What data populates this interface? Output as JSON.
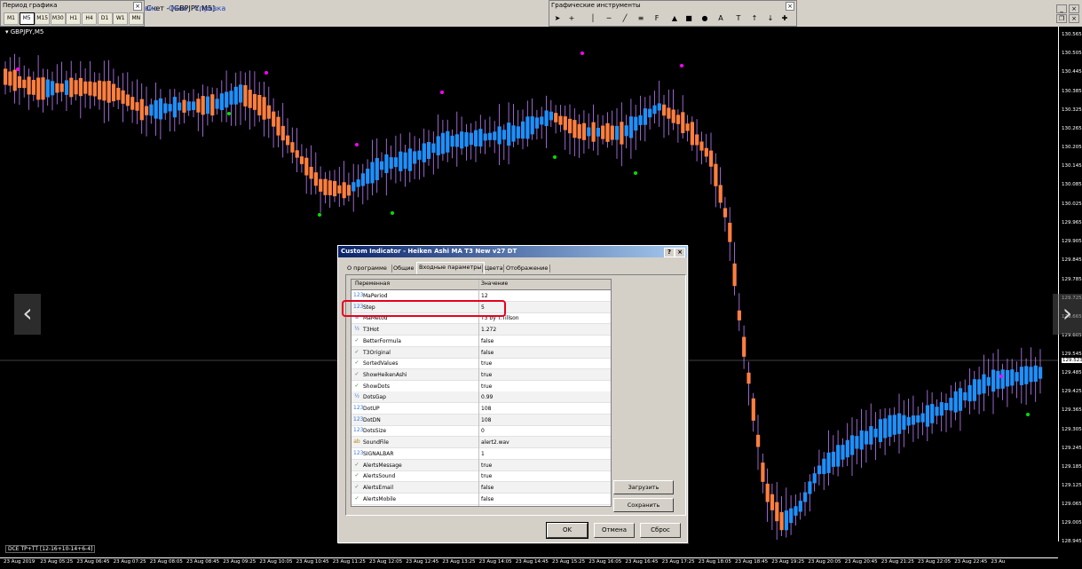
{
  "toolbar": {
    "period_panel_title": "Период графика",
    "periods": [
      "M1",
      "M5",
      "M15",
      "M30",
      "H1",
      "H4",
      "D1",
      "W1",
      "MN"
    ],
    "active_period": "M5",
    "account_label": "Счет - [GBPJPY,M5]",
    "menu": [
      "вис",
      "Окно",
      "Справка"
    ],
    "drawing_panel_title": "Графические инструменты",
    "drawing_tools": [
      "cursor",
      "crosshair",
      "vertical-line",
      "horizontal-line",
      "trend-line",
      "channel",
      "fibonacci",
      "triangle",
      "rectangle",
      "ellipse",
      "text",
      "label",
      "arrow-up",
      "arrow-down",
      "shapes"
    ]
  },
  "chart": {
    "symbol": "GBPJPY,M5",
    "status": "DCE TP+TT [12-16+10-14+6-4]",
    "current_price": "129.523",
    "y_labels": [
      "130.565",
      "130.505",
      "130.445",
      "130.385",
      "130.325",
      "130.265",
      "130.205",
      "130.145",
      "130.085",
      "130.025",
      "129.965",
      "129.905",
      "129.845",
      "129.785",
      "129.725",
      "129.665",
      "129.605",
      "129.545",
      "129.523",
      "129.485",
      "129.425",
      "129.365",
      "129.305",
      "129.245",
      "129.185",
      "129.125",
      "129.065",
      "129.005",
      "128.945"
    ],
    "x_labels": [
      "23 Aug 2019",
      "23 Aug 05:25",
      "23 Aug 06:45",
      "23 Aug 07:25",
      "23 Aug 08:05",
      "23 Aug 08:45",
      "23 Aug 09:25",
      "23 Aug 10:05",
      "23 Aug 10:45",
      "23 Aug 11:25",
      "23 Aug 12:05",
      "23 Aug 12:45",
      "23 Aug 13:25",
      "23 Aug 14:05",
      "23 Aug 14:45",
      "23 Aug 15:25",
      "23 Aug 16:05",
      "23 Aug 16:45",
      "23 Aug 17:25",
      "23 Aug 18:05",
      "23 Aug 18:45",
      "23 Aug 19:25",
      "23 Aug 20:05",
      "23 Aug 20:45",
      "23 Aug 21:25",
      "23 Aug 22:05",
      "23 Aug 22:45",
      "23 Au"
    ],
    "colors": {
      "bull": "#1e90ff",
      "bear": "#ff7f3f",
      "wick": "#c080ff",
      "dot_up": "#00e000",
      "dot_dn": "#ff00ff"
    }
  },
  "dialog": {
    "title": "Custom Indicator - Heiken Ashi MA T3 New v27 DT",
    "help": "?",
    "close": "×",
    "tabs": [
      "О программе",
      "Общие",
      "Входные параметры",
      "Цвета",
      "Отображение"
    ],
    "active_tab": "Входные параметры",
    "col_variable": "Переменная",
    "col_value": "Значение",
    "params": [
      {
        "name": "MaPeriod",
        "value": "12",
        "icon": "int"
      },
      {
        "name": "Step",
        "value": "5",
        "icon": "int"
      },
      {
        "name": "MaMetod",
        "value": "T3 by T.Tillson",
        "icon": "enum"
      },
      {
        "name": "T3Hot",
        "value": "1.272",
        "icon": "dbl"
      },
      {
        "name": "BetterFormula",
        "value": "false",
        "icon": "bool"
      },
      {
        "name": "T3Original",
        "value": "false",
        "icon": "bool"
      },
      {
        "name": "SortedValues",
        "value": "true",
        "icon": "bool"
      },
      {
        "name": "ShowHeikenAshi",
        "value": "true",
        "icon": "bool"
      },
      {
        "name": "ShowDots",
        "value": "true",
        "icon": "bool"
      },
      {
        "name": "DotsGap",
        "value": "0.99",
        "icon": "dbl"
      },
      {
        "name": "DotUP",
        "value": "108",
        "icon": "int"
      },
      {
        "name": "DotDN",
        "value": "108",
        "icon": "int"
      },
      {
        "name": "DotsSize",
        "value": "0",
        "icon": "int"
      },
      {
        "name": "SoundFile",
        "value": "alert2.wav",
        "icon": "str"
      },
      {
        "name": "SIGNALBAR",
        "value": "1",
        "icon": "int"
      },
      {
        "name": "AlertsMessage",
        "value": "true",
        "icon": "bool"
      },
      {
        "name": "AlertsSound",
        "value": "true",
        "icon": "bool"
      },
      {
        "name": "AlertsEmail",
        "value": "false",
        "icon": "bool"
      },
      {
        "name": "AlertsMobile",
        "value": "false",
        "icon": "bool"
      }
    ],
    "highlighted_param": "Step",
    "load_label": "Загрузить",
    "save_label": "Сохранить",
    "ok_label": "OK",
    "cancel_label": "Отмена",
    "reset_label": "Сброс"
  }
}
